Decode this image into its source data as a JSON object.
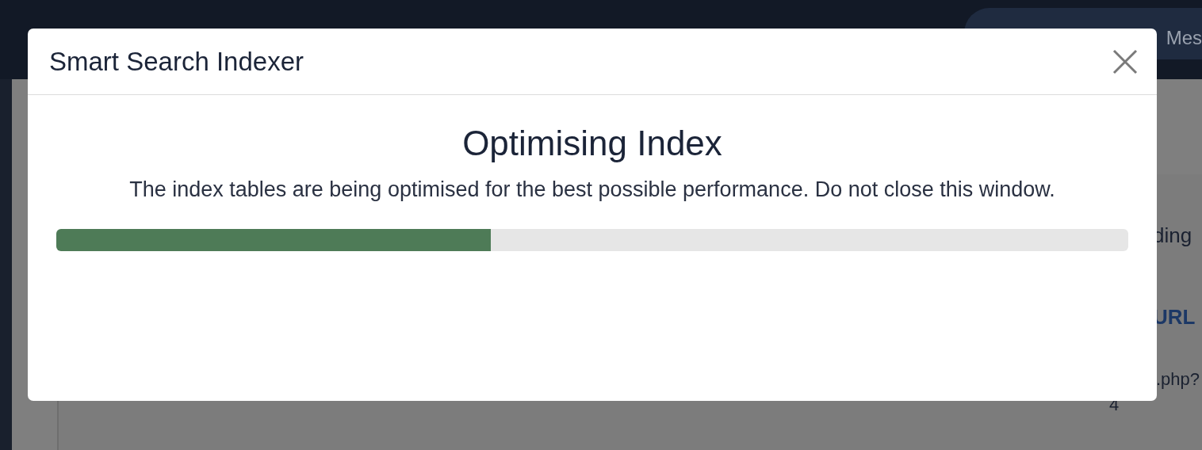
{
  "background": {
    "header_text": "Mes",
    "column_heading": "ding",
    "link_heading": "URL",
    "cell_text": ".php?",
    "cell_number": "4"
  },
  "modal": {
    "title": "Smart Search Indexer",
    "heading": "Optimising Index",
    "message": "The index tables are being optimised for the best possible performance. Do not close this window.",
    "progress": {
      "level": 0.405
    }
  }
}
